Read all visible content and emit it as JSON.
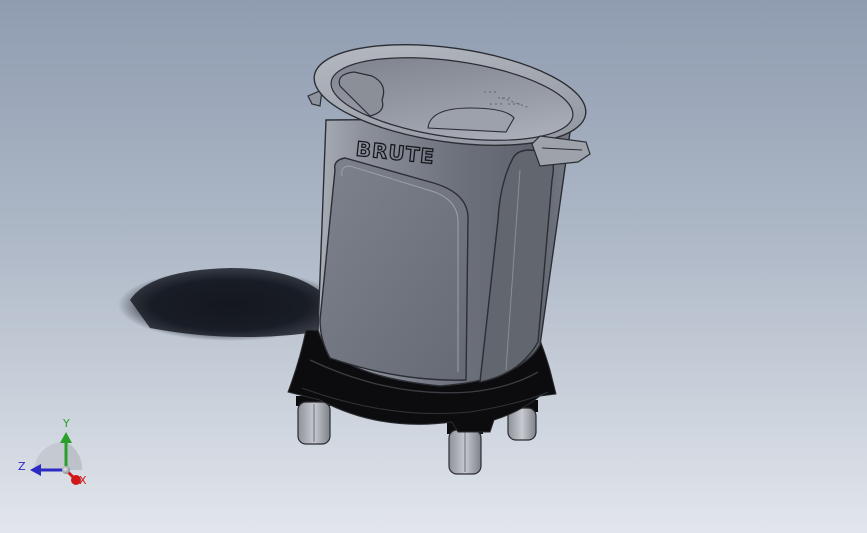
{
  "model": {
    "brand_text": "BRUTE"
  },
  "triad": {
    "x_label": "X",
    "y_label": "Y",
    "z_label": "Z",
    "x_color": "#d01818",
    "y_color": "#2aa02a",
    "z_color": "#2b2bc4"
  },
  "colors": {
    "background_top": "#8f9cb0",
    "background_bottom": "#e2e6ec",
    "can_body": "#767b86",
    "dolly": "#0c0c0e"
  }
}
